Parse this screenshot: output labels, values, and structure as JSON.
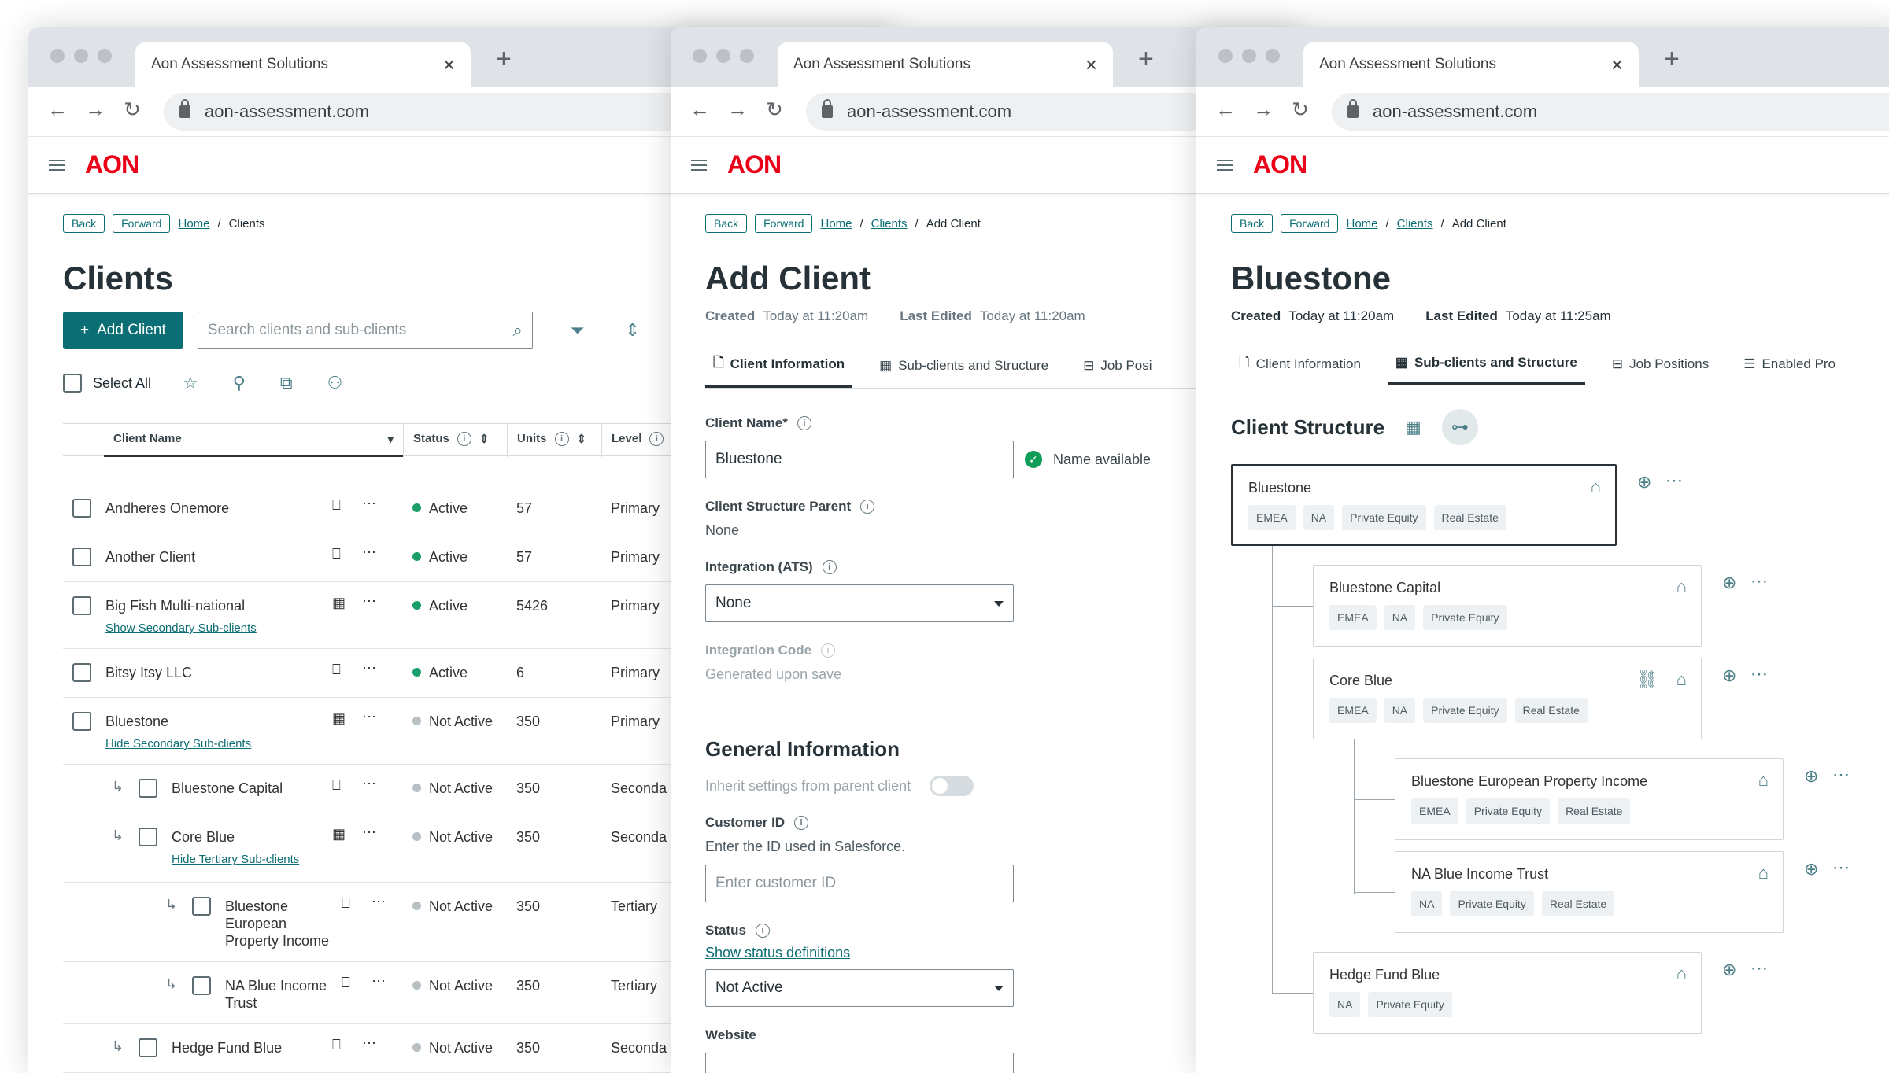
{
  "browser": {
    "tab_title": "Aon Assessment Solutions",
    "url": "aon-assessment.com"
  },
  "app": {
    "logo": "AON",
    "back": "Back",
    "forward": "Forward"
  },
  "w1": {
    "crumb_home": "Home",
    "crumb_current": "Clients",
    "title": "Clients",
    "add_client": "Add Client",
    "search_placeholder": "Search clients and sub-clients",
    "select_all": "Select All",
    "headers": {
      "name": "Client Name",
      "status": "Status",
      "units": "Units",
      "level": "Level"
    },
    "rows": [
      {
        "name": "Andheres Onemore",
        "status": "Active",
        "units": "57",
        "level": "Primary"
      },
      {
        "name": "Another Client",
        "status": "Active",
        "units": "57",
        "level": "Primary"
      },
      {
        "name": "Big Fish Multi-national",
        "link": "Show Secondary Sub-clients",
        "status": "Active",
        "units": "5426",
        "level": "Primary"
      },
      {
        "name": "Bitsy Itsy LLC",
        "status": "Active",
        "units": "6",
        "level": "Primary"
      },
      {
        "name": "Bluestone",
        "link": "Hide Secondary Sub-clients",
        "status": "Not Active",
        "units": "350",
        "level": "Primary"
      },
      {
        "name": "Bluestone Capital",
        "status": "Not Active",
        "units": "350",
        "level": "Seconda"
      },
      {
        "name": "Core Blue",
        "link": "Hide Tertiary Sub-clients",
        "status": "Not Active",
        "units": "350",
        "level": "Seconda"
      },
      {
        "name1": "Bluestone",
        "name2": "European",
        "name3": "Property Income",
        "status": "Not Active",
        "units": "350",
        "level": "Tertiary"
      },
      {
        "name1": "NA Blue Income",
        "name2": "Trust",
        "status": "Not Active",
        "units": "350",
        "level": "Tertiary"
      },
      {
        "name": "Hedge Fund Blue",
        "status": "Not Active",
        "units": "350",
        "level": "Seconda"
      }
    ]
  },
  "w2": {
    "crumb_home": "Home",
    "crumb_clients": "Clients",
    "crumb_current": "Add Client",
    "title": "Add Client",
    "created_label": "Created",
    "created_value": "Today at 11:20am",
    "edited_label": "Last Edited",
    "edited_value": "Today at 11:20am",
    "tabs": [
      "Client Information",
      "Sub-clients and Structure",
      "Job Posi"
    ],
    "client_name_label": "Client Name*",
    "client_name_value": "Bluestone",
    "name_available": "Name available",
    "parent_label": "Client Structure Parent",
    "parent_value": "None",
    "integration_label": "Integration (ATS)",
    "integration_value": "None",
    "code_label": "Integration Code",
    "code_value": "Generated upon save",
    "general_title": "General Information",
    "inherit_label": "Inherit settings from parent client",
    "customer_label": "Customer ID",
    "customer_help": "Enter the ID used in Salesforce.",
    "customer_placeholder": "Enter customer ID",
    "status_label": "Status",
    "status_link": "Show status definitions",
    "status_value": "Not Active",
    "website_label": "Website"
  },
  "w3": {
    "crumb_home": "Home",
    "crumb_clients": "Clients",
    "crumb_current": "Add Client",
    "title": "Bluestone",
    "created_label": "Created",
    "created_value": "Today at 11:20am",
    "edited_label": "Last Edited",
    "edited_value": "Today at 11:25am",
    "tabs": [
      "Client Information",
      "Sub-clients and Structure",
      "Job Positions",
      "Enabled Pro"
    ],
    "structure_title": "Client Structure",
    "nodes": [
      {
        "name": "Bluestone",
        "tags": [
          "EMEA",
          "NA",
          "Private Equity",
          "Real Estate"
        ]
      },
      {
        "name": "Bluestone Capital",
        "tags": [
          "EMEA",
          "NA",
          "Private Equity"
        ]
      },
      {
        "name": "Core Blue",
        "tags": [
          "EMEA",
          "NA",
          "Private Equity",
          "Real Estate"
        ]
      },
      {
        "name": "Bluestone European Property Income",
        "tags": [
          "EMEA",
          "Private Equity",
          "Real Estate"
        ]
      },
      {
        "name": "NA Blue Income Trust",
        "tags": [
          "NA",
          "Private Equity",
          "Real Estate"
        ]
      },
      {
        "name": "Hedge Fund Blue",
        "tags": [
          "NA",
          "Private Equity"
        ]
      }
    ]
  }
}
